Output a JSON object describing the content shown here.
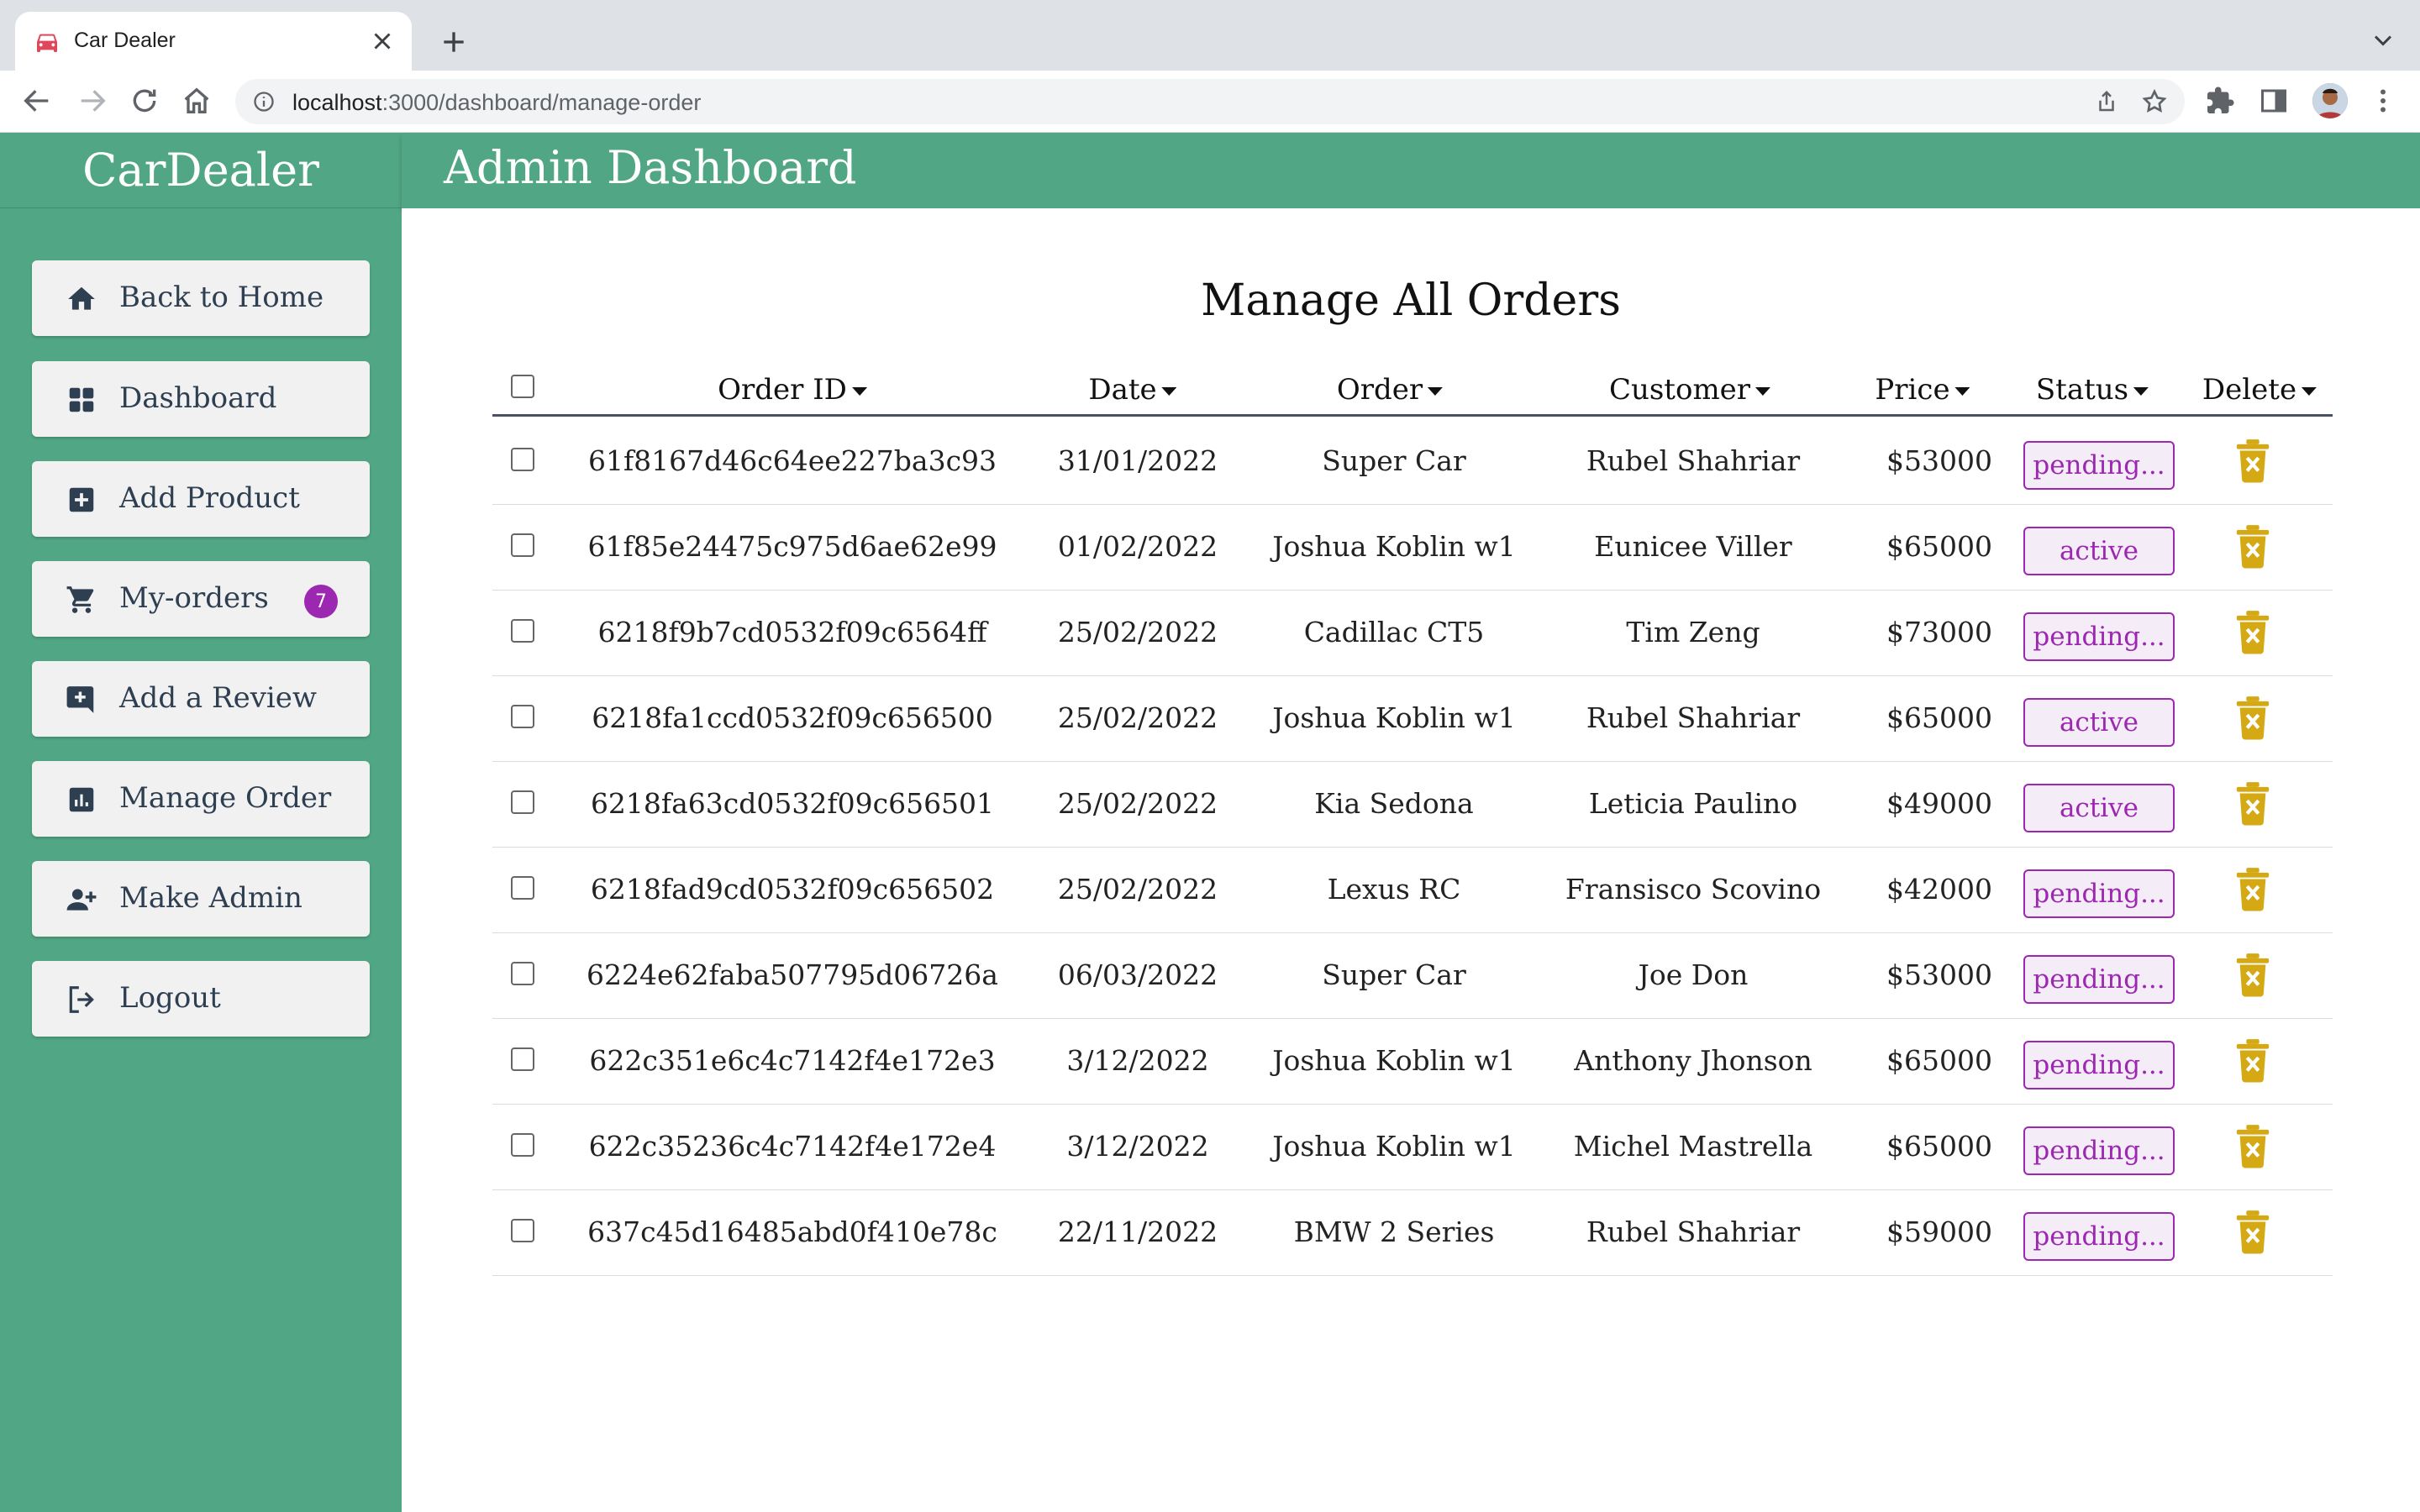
{
  "browser": {
    "tab_title": "Car Dealer",
    "url_host": "localhost",
    "url_path": ":3000/dashboard/manage-order"
  },
  "sidebar": {
    "brand": "CarDealer",
    "items": [
      {
        "label": "Back to Home",
        "icon": "home-icon"
      },
      {
        "label": "Dashboard",
        "icon": "dashboard-icon"
      },
      {
        "label": "Add Product",
        "icon": "add-box-icon"
      },
      {
        "label": "My-orders",
        "icon": "cart-icon",
        "badge": "7"
      },
      {
        "label": "Add a Review",
        "icon": "add-comment-icon"
      },
      {
        "label": "Manage Order",
        "icon": "analytics-icon"
      },
      {
        "label": "Make Admin",
        "icon": "person-add-icon"
      },
      {
        "label": "Logout",
        "icon": "logout-icon"
      }
    ]
  },
  "header": {
    "title": "Admin Dashboard"
  },
  "main": {
    "title": "Manage All Orders",
    "columns": [
      "Order ID",
      "Date",
      "Order",
      "Customer",
      "Price",
      "Status",
      "Delete"
    ],
    "rows": [
      {
        "id": "61f8167d46c64ee227ba3c93",
        "date": "31/01/2022",
        "order": "Super Car",
        "customer": "Rubel Shahriar",
        "price": "$53000",
        "status": "pending..."
      },
      {
        "id": "61f85e24475c975d6ae62e99",
        "date": "01/02/2022",
        "order": "Joshua Koblin w1",
        "customer": "Eunicee Viller",
        "price": "$65000",
        "status": "active"
      },
      {
        "id": "6218f9b7cd0532f09c6564ff",
        "date": "25/02/2022",
        "order": "Cadillac CT5",
        "customer": "Tim Zeng",
        "price": "$73000",
        "status": "pending..."
      },
      {
        "id": "6218fa1ccd0532f09c656500",
        "date": "25/02/2022",
        "order": "Joshua Koblin w1",
        "customer": "Rubel Shahriar",
        "price": "$65000",
        "status": "active"
      },
      {
        "id": "6218fa63cd0532f09c656501",
        "date": "25/02/2022",
        "order": "Kia Sedona",
        "customer": "Leticia Paulino",
        "price": "$49000",
        "status": "active"
      },
      {
        "id": "6218fad9cd0532f09c656502",
        "date": "25/02/2022",
        "order": "Lexus RC",
        "customer": "Fransisco Scovino",
        "price": "$42000",
        "status": "pending..."
      },
      {
        "id": "6224e62faba507795d06726a",
        "date": "06/03/2022",
        "order": "Super Car",
        "customer": "Joe Don",
        "price": "$53000",
        "status": "pending..."
      },
      {
        "id": "622c351e6c4c7142f4e172e3",
        "date": "3/12/2022",
        "order": "Joshua Koblin w1",
        "customer": "Anthony Jhonson",
        "price": "$65000",
        "status": "pending..."
      },
      {
        "id": "622c35236c4c7142f4e172e4",
        "date": "3/12/2022",
        "order": "Joshua Koblin w1",
        "customer": "Michel Mastrella",
        "price": "$65000",
        "status": "pending..."
      },
      {
        "id": "637c45d16485abd0f410e78c",
        "date": "22/11/2022",
        "order": "BMW 2 Series",
        "customer": "Rubel Shahriar",
        "price": "$59000",
        "status": "pending..."
      }
    ]
  },
  "colors": {
    "brand_green": "#51a785",
    "status_purple": "#9c27b0",
    "delete_gold": "#d4a914"
  }
}
